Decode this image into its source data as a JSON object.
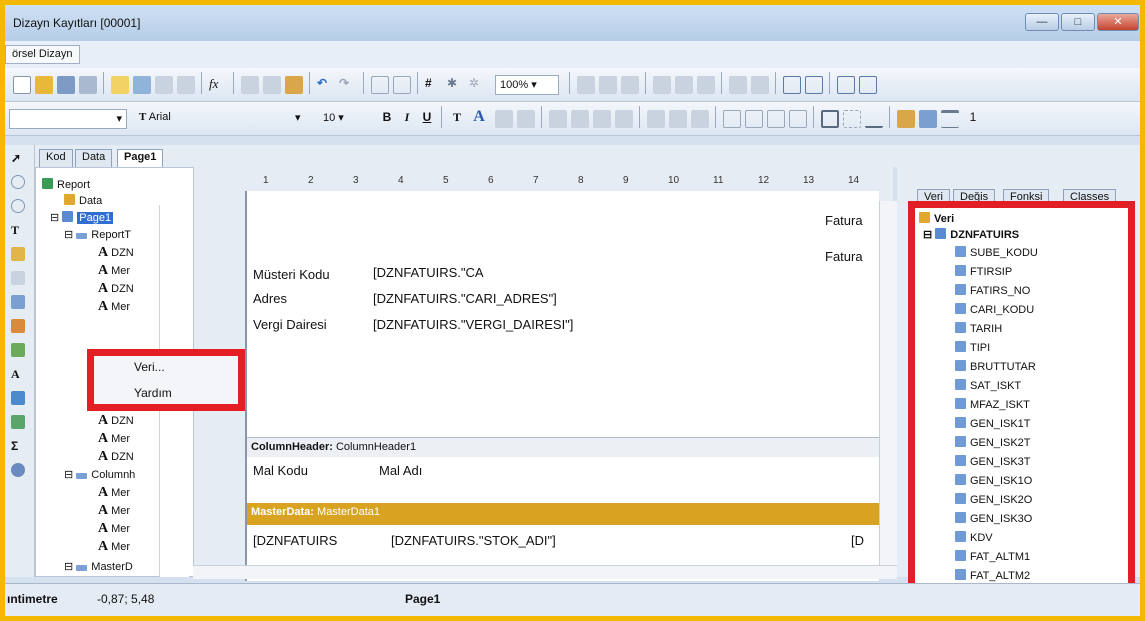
{
  "window": {
    "title": "Dizayn Kayıtları [00001]",
    "min_glyph": "—",
    "max_glyph": "□",
    "close_glyph": "✕"
  },
  "menu": {
    "item": "örsel Dizayn"
  },
  "toolbar1": {
    "zoom": "100%"
  },
  "toolbar2": {
    "font_name": "Arial",
    "font_size": "10",
    "line_width": "1",
    "bold": "B",
    "italic": "I",
    "underline": "U"
  },
  "tabs": [
    "Kod",
    "Data",
    "Page1"
  ],
  "tree": {
    "items": [
      {
        "label": "Report",
        "icon": "report-icon"
      },
      {
        "label": "Data",
        "icon": "data-icon"
      },
      {
        "label": "Page1",
        "icon": "page-icon"
      },
      {
        "label": "ReportT",
        "icon": "band-icon"
      },
      {
        "label": "DZN",
        "icon": "text-icon"
      },
      {
        "label": "Mer",
        "icon": "text-icon"
      },
      {
        "label": "DZN",
        "icon": "text-icon"
      },
      {
        "label": "Mer",
        "icon": "text-icon"
      },
      {
        "label": "DZN",
        "icon": "text-icon"
      },
      {
        "label": "Mer",
        "icon": "text-icon"
      },
      {
        "label": "DZN",
        "icon": "text-icon"
      },
      {
        "label": "Columnh",
        "icon": "band-icon"
      },
      {
        "label": "Mer",
        "icon": "text-icon"
      },
      {
        "label": "Mer",
        "icon": "text-icon"
      },
      {
        "label": "Mer",
        "icon": "text-icon"
      },
      {
        "label": "Mer",
        "icon": "text-icon"
      },
      {
        "label": "MasterD",
        "icon": "band-icon"
      }
    ]
  },
  "context_menu": {
    "items": [
      "Veri...",
      "Yardım"
    ]
  },
  "ruler": {
    "labels": [
      "1",
      "2",
      "3",
      "4",
      "5",
      "6",
      "7",
      "8",
      "9",
      "10",
      "11",
      "12",
      "13",
      "14"
    ]
  },
  "report": {
    "fields": {
      "fatura1": "Fatura",
      "fatura2": "Fatura",
      "musteri_label": "Müsteri Kodu",
      "musteri_value": "[DZNFATUIRS.\"CA",
      "adres_label": "Adres",
      "adres_value": "[DZNFATUIRS.\"CARI_ADRES\"]",
      "vergi_label": "Vergi Dairesi",
      "vergi_value": "[DZNFATUIRS.\"VERGI_DAIRESI\"]"
    },
    "column_header": {
      "label": "ColumnHeader:",
      "name": "ColumnHeader1",
      "col1": "Mal Kodu",
      "col2": "Mal Adı"
    },
    "master_data": {
      "label": "MasterData:",
      "name": "MasterData1",
      "col1": "[DZNFATUIRS",
      "col2": "[DZNFATUIRS.\"STOK_ADI\"]",
      "col3": "[D"
    }
  },
  "right_panel": {
    "tabs": [
      "Veri",
      "Değis",
      "Fonksi",
      "Classes"
    ],
    "root": "Veri",
    "table": "DZNFATUIRS",
    "fields": [
      "SUBE_KODU",
      "FTIRSIP",
      "FATIRS_NO",
      "CARI_KODU",
      "TARIH",
      "TIPI",
      "BRUTTUTAR",
      "SAT_ISKT",
      "MFAZ_ISKT",
      "GEN_ISK1T",
      "GEN_ISK2T",
      "GEN_ISK3T",
      "GEN_ISK1O",
      "GEN_ISK2O",
      "GEN_ISK3O",
      "KDV",
      "FAT_ALTM1",
      "FAT_ALTM2"
    ]
  },
  "status": {
    "unit": "ıntimetre",
    "coords": "-0,87; 5,48",
    "page": "Page1"
  },
  "colors": {
    "highlight": "#e31e24",
    "frame": "#f5b800",
    "master_band": "#d9a322"
  }
}
